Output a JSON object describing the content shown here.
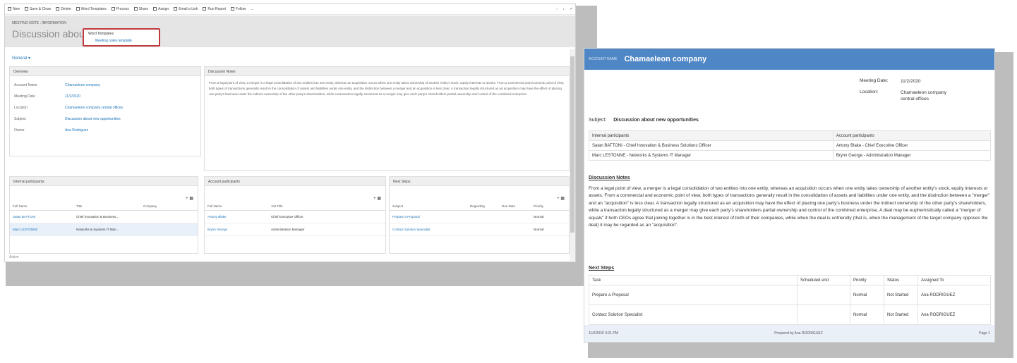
{
  "crm": {
    "commands": [
      "New",
      "Save & Close",
      "Delete",
      "Word Templates",
      "Process",
      "Share",
      "Assign",
      "Email a Link",
      "Run Report",
      "Follow",
      "..."
    ],
    "breadcrumb": "MEETING NOTE : INFORMATION",
    "title": "Discussion about new",
    "popup": {
      "option": "Word Templates",
      "sub": "Meeting notes template"
    },
    "tab": "General",
    "overview": {
      "header": "Overview",
      "fields": [
        {
          "label": "Account Name",
          "value": "Chamaeleon company"
        },
        {
          "label": "Meeting Date",
          "value": "11/2/2020"
        },
        {
          "label": "Location",
          "value": "Chamaeleon company central offices"
        },
        {
          "label": "Subject",
          "value": "Discussion about new opportunities"
        },
        {
          "label": "Owner",
          "value": "Ana Rodriguez"
        }
      ]
    },
    "discussion": {
      "header": "Discussion Notes",
      "text": "From a legal point of view, a merger is a legal consolidation of two entities into one entity, whereas an acquisition occurs when one entity takes ownership of another entity's stock, equity interests or assets. From a commercial and economic point of view, both types of transactions generally result in the consolidation of assets and liabilities under one entity, and the distinction between a merger and an acquisition is less clear. A transaction legally structured as an acquisition may have the effect of placing one party's business under the indirect ownership of the other party's shareholders, while a transaction legally structured as a merger may give each party's shareholders partial ownership and control of the combined enterprise."
    },
    "internal": {
      "header": "Internal participants",
      "columns": [
        "Full Name",
        "Title",
        "Company"
      ],
      "rows": [
        {
          "name": "Satan BATTONI",
          "title": "Chief Innovation & Business..."
        },
        {
          "name": "Marc LESTONNE",
          "title": "Networks & Systems IT Man..."
        }
      ]
    },
    "account": {
      "header": "Account participants",
      "columns": [
        "Full Name",
        "Job Title"
      ],
      "rows": [
        {
          "name": "Antony Blake",
          "title": "Chief Executive Officer"
        },
        {
          "name": "Brynn George",
          "title": "Administration Manager"
        }
      ]
    },
    "next": {
      "header": "Next Steps",
      "columns": [
        "Subject",
        "Regarding",
        "Due Date",
        "Priority"
      ],
      "rows": [
        {
          "subject": "Prepare a Proposal",
          "priority": "Normal"
        },
        {
          "subject": "Contact Solution Specialist",
          "priority": "Normal"
        }
      ]
    },
    "status": "Active"
  },
  "report": {
    "header_small": "ACCOUNT NAME",
    "header_big": "Chamaeleon company",
    "meeting_date_label": "Meeting Date:",
    "meeting_date": "11/2/2020",
    "location_label": "Location:",
    "location": "Chamaeleon company central offices",
    "subject_label": "Subject:",
    "subject": "Discussion about new opportunities",
    "participants": {
      "internal_header": "Internal participants",
      "account_header": "Account participants",
      "rows": [
        {
          "internal": "Satan BATTONI - Chief Innovation & Business Solutions Officer",
          "account": "Antony Blake - Chief Executive Officer"
        },
        {
          "internal": "Marc LESTONNE - Networks & Systems IT Manager",
          "account": "Brynn George - Administration Manager"
        }
      ]
    },
    "notes_title": "Discussion Notes",
    "notes": "From a legal point of view, a merger is a legal consolidation of two entities into one entity, whereas an acquisition occurs when one entity takes ownership of another entity's stock, equity interests or assets. From a commercial and economic point of view, both types of transactions generally result in the consolidation of assets and liabilities under one entity, and the distinction between a \"merger\" and an \"acquisition\" is less clear. A transaction legally structured as an acquisition may have the effect of placing one party's business under the indirect ownership of the other party's shareholders, while a transaction legally structured as a merger may give each party's shareholders partial ownership and control of the combined enterprise. A deal may be euphemistically called a \"merger of equals\" if both CEOs agree that joining together is in the best interest of both of their companies, while when the deal is unfriendly (that is, when the management of the target company opposes the deal) it may be regarded as an \"acquisition\".",
    "steps_title": "Next Steps",
    "steps_columns": [
      "Task",
      "Scheduled end",
      "Priority",
      "Status",
      "Assigned To"
    ],
    "steps": [
      {
        "task": "Prepare a Proposal",
        "end": "",
        "priority": "Normal",
        "status": "Not Started",
        "assigned": "Ana RODRIGUEZ"
      },
      {
        "task": "Contact Solution Specialist",
        "end": "",
        "priority": "Normal",
        "status": "Not Started",
        "assigned": "Ana RODRIGUEZ"
      }
    ],
    "footer_left": "11/2/2020 3:21 PM",
    "footer_mid": "Prepared by Ana RODRIGUEZ",
    "footer_right": "Page 1"
  }
}
